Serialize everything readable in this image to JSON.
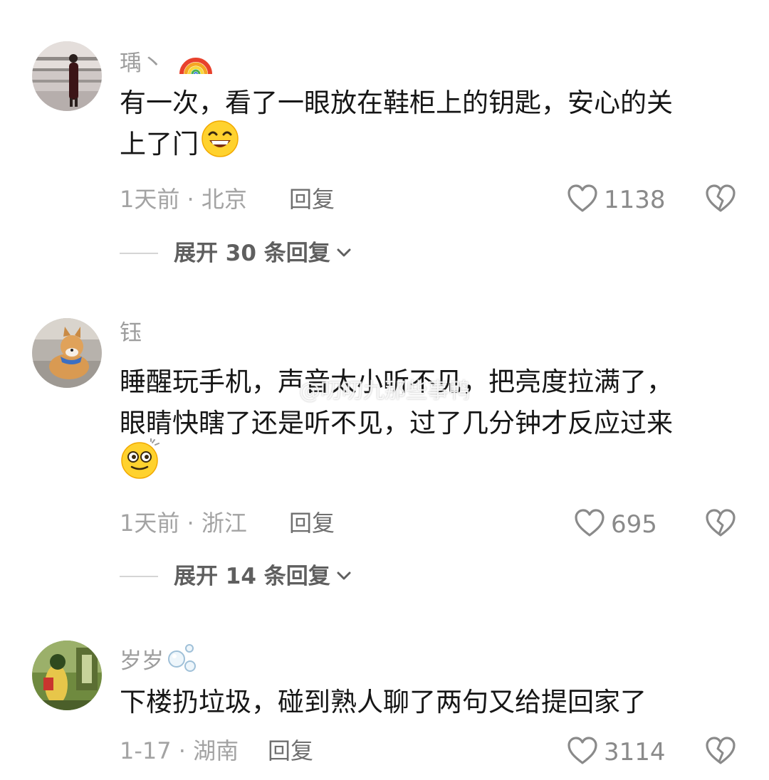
{
  "comments": [
    {
      "username": "瑀丶",
      "username_emoji": "rainbow-icon",
      "text_line1": "有一次，看了一眼放在鞋柜上的钥匙，安心的关",
      "text_line2": "上了门",
      "text_emoji": "grin-emoji-icon",
      "meta": "1天前 · 北京",
      "reply_label": "回复",
      "likes": "1138",
      "expand_label": "展开 30 条回复"
    },
    {
      "username": "钰",
      "text_line1": "睡醒玩手机，声音太小听不见，把亮度拉满了，",
      "text_line2": "眼睛快瞎了还是听不见，过了几分钟才反应过来",
      "text_emoji": "dizzy-face-emoji-icon",
      "meta": "1天前 · 浙江",
      "reply_label": "回复",
      "likes": "695",
      "expand_label": "展开 14 条回复"
    },
    {
      "username": "岁岁",
      "username_emoji": "bubbles-icon",
      "text_line1": "下楼扔垃圾，碰到熟人聊了两句又给提回家了",
      "meta": "1-17 · 湖南",
      "reply_label": "回复",
      "likes": "3114"
    }
  ],
  "watermark": "@叨叨九那些事鸭",
  "colors": {
    "text": "#161616",
    "muted": "#a3a3a3",
    "username": "#9d9d9d",
    "expand": "#5f5f5f"
  }
}
